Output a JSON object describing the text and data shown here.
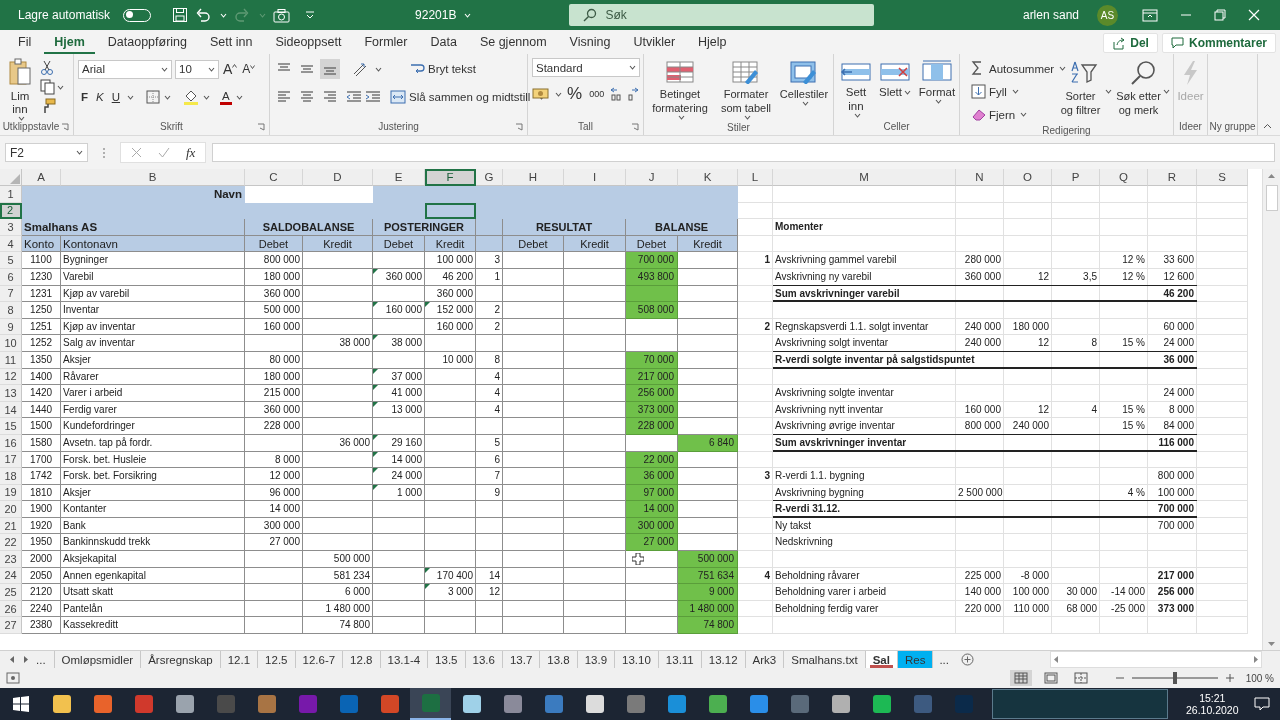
{
  "title_bar": {
    "autosave_label": "Lagre automatisk",
    "autosave_on": false,
    "file_name": "92201B",
    "search_placeholder": "Søk",
    "user": "arlen sand",
    "avatar": "AS"
  },
  "menu_tabs": [
    {
      "label": "Fil",
      "selected": false
    },
    {
      "label": "Hjem",
      "selected": true
    },
    {
      "label": "Dataoppføring",
      "selected": false
    },
    {
      "label": "Sett inn",
      "selected": false
    },
    {
      "label": "Sideoppsett",
      "selected": false
    },
    {
      "label": "Formler",
      "selected": false
    },
    {
      "label": "Data",
      "selected": false
    },
    {
      "label": "Se gjennom",
      "selected": false
    },
    {
      "label": "Visning",
      "selected": false
    },
    {
      "label": "Utvikler",
      "selected": false
    },
    {
      "label": "Hjelp",
      "selected": false
    }
  ],
  "share_button": "Del",
  "comments_button": "Kommentarer",
  "ribbon": [
    {
      "kind": "clipboard",
      "label": "Utklippstavle",
      "paste": "Lim inn"
    },
    {
      "kind": "font",
      "label": "Skrift",
      "font": "Arial",
      "size": "10",
      "grow": "A",
      "shrink": "A",
      "bold": "F",
      "italic": "K",
      "underline": "U",
      "font_color": "A"
    },
    {
      "kind": "alignment",
      "label": "Justering",
      "valign_buttons": [
        {
          "selected": false
        },
        {
          "selected": false
        },
        {
          "selected": true
        }
      ],
      "wrap": "Bryt tekst",
      "merge": "Slå sammen og midtstill"
    },
    {
      "kind": "number",
      "label": "Tall",
      "format": "Standard",
      "percent": "%",
      "thousands": "000"
    },
    {
      "kind": "styles",
      "label": "Stiler",
      "buttons": [
        "Betinget formatering",
        "Formater som tabell",
        "Cellestiler"
      ]
    },
    {
      "kind": "cells",
      "label": "Celler",
      "buttons": [
        "Sett inn",
        "Slett",
        "Format"
      ]
    },
    {
      "kind": "editing",
      "label": "Redigering",
      "small": [
        "Autosummer",
        "Fyll",
        "Fjern"
      ],
      "big": [
        "Sorter og filtrer",
        "Søk etter og merk"
      ]
    },
    {
      "kind": "ideas",
      "label": "Ideer",
      "button": "Ideer",
      "disabled": true
    },
    {
      "kind": "custom",
      "label": "Ny gruppe"
    }
  ],
  "formula_bar": {
    "name_box": "F2",
    "fx": "fx"
  },
  "grid": {
    "columns": [
      {
        "label": "A",
        "selected": false
      },
      {
        "label": "B",
        "selected": false
      },
      {
        "label": "C",
        "selected": false
      },
      {
        "label": "D",
        "selected": false
      },
      {
        "label": "E",
        "selected": false
      },
      {
        "label": "F",
        "selected": true
      },
      {
        "label": "G",
        "selected": false
      },
      {
        "label": "H",
        "selected": false
      },
      {
        "label": "I",
        "selected": false
      },
      {
        "label": "J",
        "selected": false
      },
      {
        "label": "K",
        "selected": false
      },
      {
        "label": "L",
        "selected": false
      },
      {
        "label": "M",
        "selected": false
      },
      {
        "label": "N",
        "selected": false
      },
      {
        "label": "O",
        "selected": false
      },
      {
        "label": "P",
        "selected": false
      },
      {
        "label": "Q",
        "selected": false
      },
      {
        "label": "R",
        "selected": false
      },
      {
        "label": "S",
        "selected": false
      }
    ],
    "rows": [
      {
        "n": "1",
        "kind": "title",
        "selected": false,
        "cells": [
          "",
          {
            "text": "Navn",
            "bold": true
          },
          {
            "kind": "input"
          },
          {
            "merged": true
          },
          "",
          "",
          "",
          "",
          "",
          "",
          "",
          "",
          "",
          "",
          "",
          "",
          "",
          "",
          ""
        ]
      },
      {
        "n": "2",
        "kind": "title",
        "selected": true,
        "cells": [
          "",
          "",
          "",
          "",
          "",
          "",
          "",
          "",
          "",
          "",
          "",
          "",
          "",
          "",
          "",
          "",
          "",
          "",
          ""
        ]
      },
      {
        "n": "3",
        "kind": "header",
        "selected": false,
        "cells": [
          {
            "text": "Smalhans AS",
            "bold": true
          },
          {
            "merged": true
          },
          {
            "text": "SALDOBALANSE",
            "bold": true
          },
          {
            "merged": true
          },
          {
            "text": "POSTERINGER",
            "bold": true
          },
          {
            "merged": true
          },
          "",
          {
            "text": "RESULTAT",
            "bold": true
          },
          {
            "merged": true
          },
          {
            "text": "BALANSE",
            "bold": true
          },
          {
            "merged": true
          },
          "",
          {
            "text": "Momenter",
            "bold": true
          },
          "",
          "",
          "",
          "",
          "",
          ""
        ]
      },
      {
        "n": "4",
        "kind": "header",
        "selected": false,
        "cells": [
          "Konto",
          "Kontonavn",
          "Debet",
          "Kredit",
          "Debet",
          "Kredit",
          "",
          "Debet",
          "Kredit",
          "Debet",
          "Kredit",
          "",
          "",
          "",
          "",
          "",
          "",
          "",
          ""
        ]
      },
      {
        "n": "5",
        "kind": "data",
        "selected": false,
        "cells": [
          "1100",
          "Bygninger",
          "800 000",
          "",
          "",
          "100 000",
          "3",
          "",
          "",
          {
            "text": "700 000",
            "highlighted": true
          },
          "",
          {
            "text": "1",
            "bold": true
          },
          "Avskrivning gammel varebil",
          "280 000",
          "",
          "",
          "12 %",
          "33 600",
          ""
        ]
      },
      {
        "n": "6",
        "kind": "data",
        "selected": false,
        "rule_thin": true,
        "cells": [
          "1230",
          "Varebil",
          "180 000",
          "",
          {
            "text": "360 000",
            "flag": true
          },
          "46 200",
          "1",
          "",
          "",
          {
            "text": "493 800",
            "highlighted": true
          },
          "",
          "",
          "Avskrivning ny varebil",
          "360 000",
          "12",
          "3,5",
          "12 %",
          "12 600",
          ""
        ]
      },
      {
        "n": "7",
        "kind": "data",
        "selected": false,
        "rule_thick": true,
        "cells": [
          "1231",
          "Kjøp av varebil",
          "360 000",
          "",
          "",
          "360 000",
          "",
          "",
          "",
          {
            "highlighted": true
          },
          "",
          "",
          {
            "text": "Sum avskrivninger varebil",
            "bold": true
          },
          "",
          "",
          "",
          "",
          {
            "text": "46 200",
            "bold": true
          },
          ""
        ]
      },
      {
        "n": "8",
        "kind": "data",
        "selected": false,
        "cells": [
          "1250",
          "Inventar",
          "500 000",
          "",
          {
            "text": "160 000",
            "flag": true
          },
          {
            "text": "152 000",
            "flag": true
          },
          "2",
          "",
          "",
          {
            "text": "508 000",
            "highlighted": true
          },
          "",
          "",
          "",
          "",
          "",
          "",
          "",
          "",
          ""
        ]
      },
      {
        "n": "9",
        "kind": "data",
        "selected": false,
        "cells": [
          "1251",
          "Kjøp av inventar",
          "160 000",
          "",
          "",
          "160 000",
          "2",
          "",
          "",
          "",
          "",
          {
            "text": "2",
            "bold": true
          },
          "Regnskapsverdi 1.1. solgt inventar",
          "240 000",
          "180 000",
          "",
          "",
          "60 000",
          ""
        ]
      },
      {
        "n": "10",
        "kind": "data",
        "selected": false,
        "rule_thin": true,
        "cells": [
          "1252",
          "Salg av inventar",
          "",
          "38 000",
          {
            "text": "38 000",
            "flag": true
          },
          "",
          "",
          "",
          "",
          "",
          "",
          "",
          "Avskrivning solgt inventar",
          "240 000",
          "12",
          "8",
          "15 %",
          "24 000",
          ""
        ]
      },
      {
        "n": "11",
        "kind": "data",
        "selected": false,
        "rule_thick": true,
        "cells": [
          "1350",
          "Aksjer",
          "80 000",
          "",
          "",
          "10 000",
          "8",
          "",
          "",
          {
            "text": "70 000",
            "highlighted": true
          },
          "",
          "",
          {
            "text": "R-verdi solgte inventar på salgstidspuntet",
            "bold": true
          },
          {
            "merged": true
          },
          "",
          "",
          "",
          {
            "text": "36 000",
            "bold": true
          },
          ""
        ]
      },
      {
        "n": "12",
        "kind": "data",
        "selected": false,
        "cells": [
          "1400",
          "Råvarer",
          "180 000",
          "",
          {
            "text": "37 000",
            "flag": true
          },
          "",
          "4",
          "",
          "",
          {
            "text": "217 000",
            "highlighted": true
          },
          "",
          "",
          "",
          "",
          "",
          "",
          "",
          "",
          ""
        ]
      },
      {
        "n": "13",
        "kind": "data",
        "selected": false,
        "cells": [
          "1420",
          "Varer i arbeid",
          "215 000",
          "",
          {
            "text": "41 000",
            "flag": true
          },
          "",
          "4",
          "",
          "",
          {
            "text": "256 000",
            "highlighted": true
          },
          "",
          "",
          "Avskrivning solgte inventar",
          "",
          "",
          "",
          "",
          "24 000",
          ""
        ]
      },
      {
        "n": "14",
        "kind": "data",
        "selected": false,
        "cells": [
          "1440",
          "Ferdig varer",
          "360 000",
          "",
          {
            "text": "13 000",
            "flag": true
          },
          "",
          "4",
          "",
          "",
          {
            "text": "373 000",
            "highlighted": true
          },
          "",
          "",
          "Avskrivning nytt inventar",
          "160 000",
          "12",
          "4",
          "15 %",
          "8 000",
          ""
        ]
      },
      {
        "n": "15",
        "kind": "data",
        "selected": false,
        "rule_thin": true,
        "cells": [
          "1500",
          "Kundefordringer",
          "228 000",
          "",
          "",
          "",
          "",
          "",
          "",
          {
            "text": "228 000",
            "highlighted": true
          },
          "",
          "",
          "Avskrivning øvrige inventar",
          "800 000",
          "240 000",
          "",
          "15 %",
          "84 000",
          ""
        ]
      },
      {
        "n": "16",
        "kind": "data",
        "selected": false,
        "rule_thick": true,
        "cells": [
          "1580",
          "Avsetn. tap på fordr.",
          "",
          "36 000",
          {
            "text": "29 160",
            "flag": true
          },
          "",
          "5",
          "",
          "",
          "",
          {
            "text": "6 840",
            "highlighted": true
          },
          "",
          {
            "text": "Sum avskrivninger inventar",
            "bold": true
          },
          "",
          "",
          "",
          "",
          {
            "text": "116 000",
            "bold": true
          },
          ""
        ]
      },
      {
        "n": "17",
        "kind": "data",
        "selected": false,
        "cells": [
          "1700",
          "Forsk. bet. Husleie",
          "8 000",
          "",
          {
            "text": "14 000",
            "flag": true
          },
          "",
          "6",
          "",
          "",
          {
            "text": "22 000",
            "highlighted": true
          },
          "",
          "",
          "",
          "",
          "",
          "",
          "",
          "",
          ""
        ]
      },
      {
        "n": "18",
        "kind": "data",
        "selected": false,
        "cells": [
          "1742",
          "Forsk. bet. Forsikring",
          "12 000",
          "",
          {
            "text": "24 000",
            "flag": true
          },
          "",
          "7",
          "",
          "",
          {
            "text": "36 000",
            "highlighted": true
          },
          "",
          {
            "text": "3",
            "bold": true
          },
          "R-verdi 1.1. bygning",
          "",
          "",
          "",
          "",
          "800 000",
          ""
        ]
      },
      {
        "n": "19",
        "kind": "data",
        "selected": false,
        "rule_thin": true,
        "cells": [
          "1810",
          "Aksjer",
          "96 000",
          "",
          {
            "text": "1 000",
            "flag": true
          },
          "",
          "9",
          "",
          "",
          {
            "text": "97 000",
            "highlighted": true
          },
          "",
          "",
          "Avskrivning bygning",
          "2 500 000",
          "",
          "",
          "4 %",
          "100 000",
          ""
        ]
      },
      {
        "n": "20",
        "kind": "data",
        "selected": false,
        "rule_thick": true,
        "cells": [
          "1900",
          "Kontanter",
          "14 000",
          "",
          "",
          "",
          "",
          "",
          "",
          {
            "text": "14 000",
            "highlighted": true
          },
          "",
          "",
          {
            "text": "R-verdi 31.12.",
            "bold": true
          },
          "",
          "",
          "",
          "",
          {
            "text": "700 000",
            "bold": true
          },
          ""
        ]
      },
      {
        "n": "21",
        "kind": "data",
        "selected": false,
        "cells": [
          "1920",
          "Bank",
          "300 000",
          "",
          "",
          "",
          "",
          "",
          "",
          {
            "text": "300 000",
            "highlighted": true
          },
          "",
          "",
          "Ny takst",
          "",
          "",
          "",
          "",
          "700 000",
          ""
        ]
      },
      {
        "n": "22",
        "kind": "data",
        "selected": false,
        "cells": [
          "1950",
          "Bankinnskudd trekk",
          "27 000",
          "",
          "",
          "",
          "",
          "",
          "",
          {
            "text": "27 000",
            "highlighted": true
          },
          "",
          "",
          "Nedskrivning",
          "",
          "",
          "",
          "",
          "",
          ""
        ]
      },
      {
        "n": "23",
        "kind": "data",
        "selected": false,
        "cells": [
          "2000",
          "Aksjekapital",
          "",
          "500 000",
          "",
          "",
          "",
          "",
          "",
          {
            "cursor": true
          },
          {
            "text": "500 000",
            "highlighted": true
          },
          "",
          "",
          "",
          "",
          "",
          "",
          "",
          ""
        ]
      },
      {
        "n": "24",
        "kind": "data",
        "selected": false,
        "cells": [
          "2050",
          "Annen egenkapital",
          "",
          "581 234",
          "",
          {
            "text": "170 400",
            "flag": true
          },
          "14",
          "",
          "",
          "",
          {
            "text": "751 634",
            "highlighted": true
          },
          {
            "text": "4",
            "bold": true
          },
          "Beholdning råvarer",
          "225 000",
          "-8 000",
          "",
          "",
          {
            "text": "217 000",
            "bold": true
          },
          ""
        ]
      },
      {
        "n": "25",
        "kind": "data",
        "selected": false,
        "cells": [
          "2120",
          "Utsatt skatt",
          "",
          "6 000",
          "",
          {
            "text": "3 000",
            "flag": true
          },
          "12",
          "",
          "",
          "",
          {
            "text": "9 000",
            "highlighted": true
          },
          "",
          "Beholdning varer i arbeid",
          "140 000",
          "100 000",
          "30 000",
          "-14 000",
          {
            "text": "256 000",
            "bold": true
          },
          ""
        ]
      },
      {
        "n": "26",
        "kind": "data",
        "selected": false,
        "cells": [
          "2240",
          "Pantelån",
          "",
          "1 480 000",
          "",
          "",
          "",
          "",
          "",
          "",
          {
            "text": "1 480 000",
            "highlighted": true
          },
          "",
          "Beholdning ferdig varer",
          "220 000",
          "110 000",
          "68 000",
          "-25 000",
          {
            "text": "373 000",
            "bold": true
          },
          ""
        ]
      },
      {
        "n": "27",
        "kind": "data",
        "selected": false,
        "cells": [
          "2380",
          "Kassekreditt",
          "",
          "74 800",
          "",
          "",
          "",
          "",
          "",
          "",
          {
            "text": "74 800",
            "highlighted": true
          },
          "",
          "",
          "",
          "",
          "",
          "",
          "",
          ""
        ]
      }
    ]
  },
  "sheet_tabs": {
    "more_left": "...",
    "more_right": "...",
    "tabs": [
      {
        "label": "Omløpsmidler",
        "selected": false
      },
      {
        "label": "Årsregnskap",
        "selected": false
      },
      {
        "label": "12.1",
        "selected": false
      },
      {
        "label": "12.5",
        "selected": false
      },
      {
        "label": "12.6-7",
        "selected": false
      },
      {
        "label": "12.8",
        "selected": false
      },
      {
        "label": "13.1-4",
        "selected": false
      },
      {
        "label": "13.5",
        "selected": false
      },
      {
        "label": "13.6",
        "selected": false
      },
      {
        "label": "13.7",
        "selected": false
      },
      {
        "label": "13.8",
        "selected": false
      },
      {
        "label": "13.9",
        "selected": false
      },
      {
        "label": "13.10",
        "selected": false
      },
      {
        "label": "13.11",
        "selected": false
      },
      {
        "label": "13.12",
        "selected": false
      },
      {
        "label": "Ark3",
        "selected": false
      },
      {
        "label": "Smalhans.txt",
        "selected": false
      },
      {
        "label": "Sal",
        "selected": true,
        "color": "#c0504d"
      },
      {
        "label": "Res",
        "selected": false,
        "color": "#00b0f0"
      }
    ]
  },
  "status_bar": {
    "views": [
      {
        "kind": "normal",
        "selected": true
      },
      {
        "kind": "layout",
        "selected": false
      },
      {
        "kind": "pagebreak",
        "selected": false
      }
    ],
    "zoom_slider": {
      "level": 0.5
    },
    "zoom": "100 %"
  },
  "taskbar": {
    "apps": [
      {
        "color": "#f2c14e",
        "selected": false
      },
      {
        "color": "#e8632b",
        "selected": false
      },
      {
        "color": "#d0392c",
        "selected": false
      },
      {
        "color": "#9aa3ad",
        "selected": false
      },
      {
        "color": "#4a4a4a",
        "selected": false
      },
      {
        "color": "#a87444",
        "selected": false
      },
      {
        "color": "#7719aa",
        "selected": false
      },
      {
        "color": "#0a64b4",
        "selected": false
      },
      {
        "color": "#d24726",
        "selected": false
      },
      {
        "color": "#1d6f42",
        "selected": true
      },
      {
        "color": "#9fd1e8",
        "selected": false
      },
      {
        "color": "#8a8a9a",
        "selected": false
      },
      {
        "color": "#3b7bbf",
        "selected": false
      },
      {
        "color": "#dcdcdc",
        "selected": false
      },
      {
        "color": "#7a7a7a",
        "selected": false
      },
      {
        "color": "#1a8fd8",
        "selected": false
      },
      {
        "color": "#4caf50",
        "selected": false
      },
      {
        "color": "#2a8ee8",
        "selected": false
      },
      {
        "color": "#5a6a7a",
        "selected": false
      },
      {
        "color": "#b0b0b0",
        "selected": false
      },
      {
        "color": "#1db954",
        "selected": false
      },
      {
        "color": "#3d5a80",
        "selected": false
      },
      {
        "color": "#0b2a4a",
        "selected": false
      }
    ],
    "time": "15:21",
    "date": "26.10.2020"
  }
}
